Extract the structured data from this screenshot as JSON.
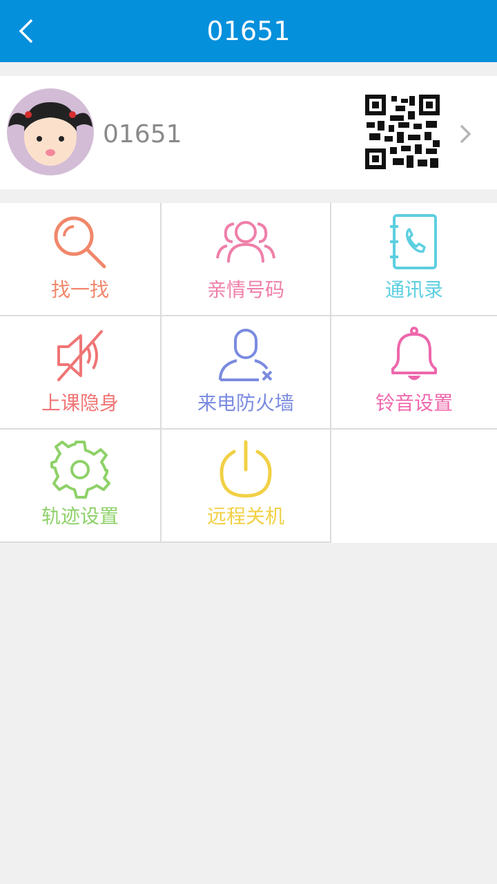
{
  "header": {
    "title": "01651",
    "back_icon": "chevron-left-icon"
  },
  "profile": {
    "name": "01651",
    "avatar_icon": "girl-avatar-icon",
    "qr_icon": "qr-code-icon",
    "arrow_icon": "chevron-right-icon"
  },
  "menu": [
    {
      "label": "找一找",
      "icon": "search-icon",
      "color": "#f0876a"
    },
    {
      "label": "亲情号码",
      "icon": "family-contacts-icon",
      "color": "#ef7fa9"
    },
    {
      "label": "通讯录",
      "icon": "address-book-icon",
      "color": "#5ccfe0"
    },
    {
      "label": "上课隐身",
      "icon": "mute-speaker-icon",
      "color": "#f07575"
    },
    {
      "label": "来电防火墙",
      "icon": "block-caller-icon",
      "color": "#7b8be0"
    },
    {
      "label": "铃音设置",
      "icon": "bell-icon",
      "color": "#ee67ac"
    },
    {
      "label": "轨迹设置",
      "icon": "gear-icon",
      "color": "#8ed169"
    },
    {
      "label": "远程关机",
      "icon": "power-icon",
      "color": "#f1d045"
    }
  ]
}
